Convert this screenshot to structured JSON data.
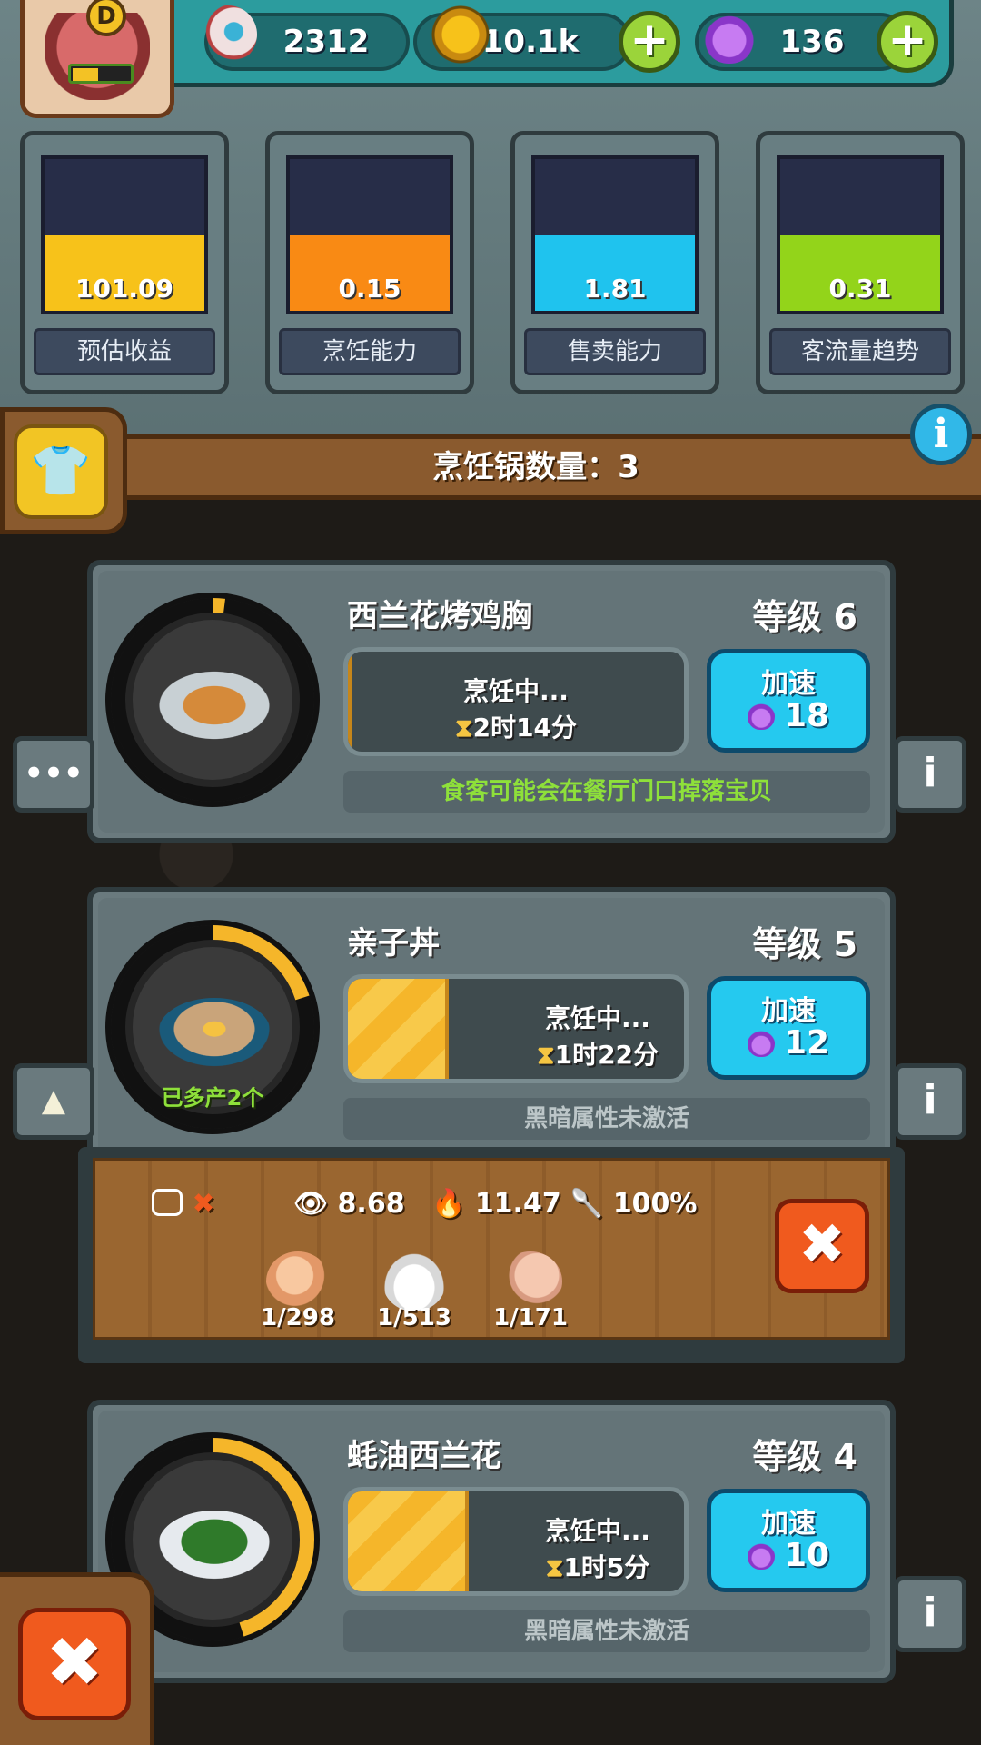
{
  "header": {
    "rank": "D",
    "resources": [
      {
        "icon": "eyeball-icon",
        "value": "2312"
      },
      {
        "icon": "gold-coin-icon",
        "value": "10.1k"
      },
      {
        "icon": "potion-icon",
        "value": "136"
      }
    ],
    "plus_symbol": "+"
  },
  "gauges": [
    {
      "value": "101.09",
      "label": "预估收益",
      "color": "#f7c21a",
      "level": 0.5
    },
    {
      "value": "0.15",
      "label": "烹饪能力",
      "color": "#f98a14",
      "level": 0.5
    },
    {
      "value": "1.81",
      "label": "售卖能力",
      "color": "#1fc3ee",
      "level": 0.5
    },
    {
      "value": "0.31",
      "label": "客流量趋势",
      "color": "#93d41a",
      "level": 0.5
    }
  ],
  "banner": {
    "text": "烹饪锅数量：3"
  },
  "info_symbol": "i",
  "cards": [
    {
      "name": "西兰花烤鸡胸",
      "level": "等级 6",
      "status": "烹饪中...",
      "time": "2时14分",
      "cook_progress": 0.0,
      "ring_progress": 0.02,
      "speed_label": "加速",
      "speed_cost": "18",
      "footer": "食客可能会在餐厅门口掉落宝贝",
      "footer_color": "#8ee03a",
      "side_left": "•••",
      "side_right": "i"
    },
    {
      "name": "亲子丼",
      "level": "等级 5",
      "status": "烹饪中...",
      "time": "1时22分",
      "cook_progress": 0.3,
      "ring_progress": 0.2,
      "pot_note": "已多产2个",
      "speed_label": "加速",
      "speed_cost": "12",
      "footer": "黑暗属性未激活",
      "footer_color": "#bcc6c8",
      "side_left": "▲",
      "side_right": "i"
    },
    {
      "name": "蚝油西兰花",
      "level": "等级 4",
      "status": "烹饪中...",
      "time": "1时5分",
      "cook_progress": 0.36,
      "ring_progress": 0.45,
      "speed_label": "加速",
      "speed_cost": "10",
      "footer": "黑暗属性未激活",
      "footer_color": "#bcc6c8",
      "side_right": "i"
    }
  ],
  "detail": {
    "crossed": "✖",
    "stats": [
      {
        "icon": "eye-icon",
        "value": "8.68"
      },
      {
        "icon": "flame-icon",
        "value": "11.47"
      },
      {
        "icon": "spatula-icon",
        "value": "100%"
      }
    ],
    "ingredients": [
      {
        "icon": "egg-icon",
        "count": "1/298"
      },
      {
        "icon": "rice-icon",
        "count": "1/513"
      },
      {
        "icon": "chicken-leg-icon",
        "count": "1/171"
      }
    ],
    "remove_symbol": "✖"
  },
  "close_symbol": "✖",
  "hourglass": "⧗"
}
